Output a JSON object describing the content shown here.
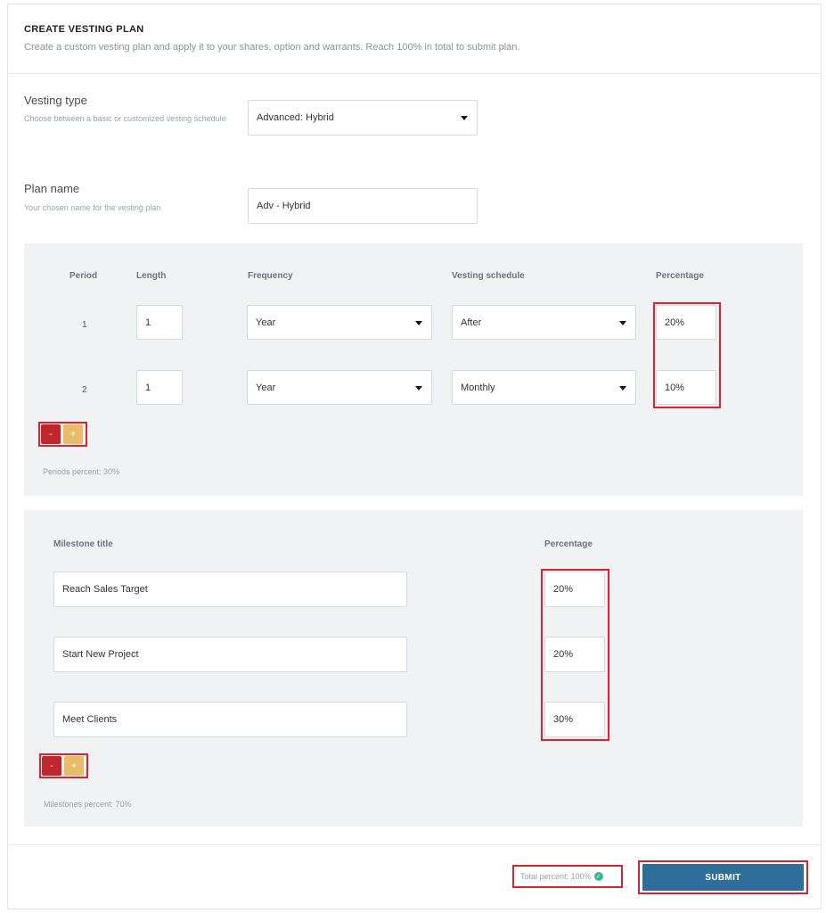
{
  "header": {
    "title": "CREATE VESTING PLAN",
    "description": "Create a custom vesting plan and apply it to your shares, option and warrants. Reach 100% in total to submit plan."
  },
  "vesting_type": {
    "label": "Vesting type",
    "help": "Choose between a basic or customized vesting schedule",
    "value": "Advanced: Hybrid"
  },
  "plan_name": {
    "label": "Plan name",
    "help": "Your chosen name for the vesting plan",
    "value": "Adv - Hybrid"
  },
  "periods": {
    "headers": {
      "period": "Period",
      "length": "Length",
      "frequency": "Frequency",
      "schedule": "Vesting schedule",
      "percentage": "Percentage"
    },
    "rows": [
      {
        "period": "1",
        "length": "1",
        "frequency": "Year",
        "schedule": "After",
        "percentage": "20%"
      },
      {
        "period": "2",
        "length": "1",
        "frequency": "Year",
        "schedule": "Monthly",
        "percentage": "10%"
      }
    ],
    "minus_label": "-",
    "plus_label": "+",
    "summary": "Periods percent: 30%"
  },
  "milestones": {
    "headers": {
      "title": "Milestone title",
      "percentage": "Percentage"
    },
    "rows": [
      {
        "title": "Reach Sales Target",
        "percentage": "20%"
      },
      {
        "title": "Start New Project",
        "percentage": "20%"
      },
      {
        "title": "Meet Clients",
        "percentage": "30%"
      }
    ],
    "minus_label": "-",
    "plus_label": "+",
    "summary": "Milestones percent: 70%"
  },
  "footer": {
    "total": "Total percent: 100%",
    "check_icon": "check-circle-icon",
    "submit_label": "SUBMIT"
  },
  "colors": {
    "submit": "#2f6e9a",
    "minus": "#c0262d",
    "plus": "#e8bd6a",
    "highlight": "#d9232d",
    "check": "#3ab795"
  }
}
